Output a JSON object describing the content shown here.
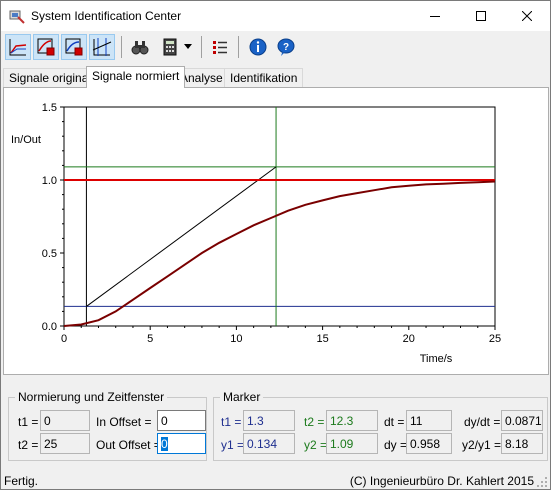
{
  "window": {
    "title": "System Identification Center"
  },
  "toolbar": {
    "icons": [
      "signal-plot-icon",
      "step-plot-icon",
      "fit-plot-icon",
      "marker-cursor-icon",
      "binoculars-icon",
      "calculator-icon",
      "dropdown-arrow-icon",
      "list-settings-icon",
      "info-icon",
      "help-icon"
    ]
  },
  "tabs": [
    "Signale original",
    "Signale normiert",
    "Analyse",
    "Identifikation"
  ],
  "active_tab": "Signale normiert",
  "chart_data": {
    "type": "line",
    "ylabel": "In/Out",
    "xlabel": "Time/s",
    "xlim": [
      0,
      25
    ],
    "ylim": [
      0,
      1.5
    ],
    "xticks": [
      "0",
      "5",
      "10",
      "15",
      "20",
      "25"
    ],
    "yticks": [
      "0.0",
      "0.5",
      "1.0",
      "1.5"
    ],
    "series": [
      {
        "color": "#dd0000",
        "x": [
          0,
          1.3,
          25
        ],
        "y": [
          1.0,
          1.0,
          1.0
        ]
      },
      {
        "color": "#7a0000",
        "x": [
          0,
          1,
          2,
          3,
          4,
          5,
          6,
          7,
          8,
          9,
          10,
          11,
          12,
          13,
          14,
          15,
          16,
          17,
          18,
          19,
          20,
          21,
          22,
          23,
          24,
          25
        ],
        "y": [
          0.0,
          0.01,
          0.04,
          0.1,
          0.18,
          0.26,
          0.34,
          0.42,
          0.5,
          0.57,
          0.63,
          0.69,
          0.74,
          0.79,
          0.83,
          0.86,
          0.89,
          0.91,
          0.93,
          0.95,
          0.96,
          0.97,
          0.975,
          0.98,
          0.985,
          0.99
        ]
      }
    ],
    "markers": {
      "t1": 1.3,
      "t2": 12.3,
      "y1": 0.134,
      "y2": 1.09
    }
  },
  "norm": {
    "title": "Normierung und Zeitfenster",
    "t1_label": "t1 =",
    "t1": "0",
    "t2_label": "t2 =",
    "t2": "25",
    "in_offset_label": "In Offset =",
    "in_offset": "0",
    "out_offset_label": "Out Offset =",
    "out_offset": "0"
  },
  "marker": {
    "title": "Marker",
    "t1_label": "t1 =",
    "t1": "1.3",
    "t2_label": "t2 =",
    "t2": "12.3",
    "dt_label": "dt =",
    "dt": "11",
    "dydt_label": "dy/dt =",
    "dydt": "0.0871",
    "y1_label": "y1 =",
    "y1": "0.134",
    "y2_label": "y2 =",
    "y2": "1.09",
    "dy_label": "dy =",
    "dy": "0.958",
    "ratio_label": "y2/y1 =",
    "ratio": "8.18"
  },
  "status": {
    "left": "Fertig.",
    "right": "(C) Ingenieurbüro Dr. Kahlert 2015"
  }
}
